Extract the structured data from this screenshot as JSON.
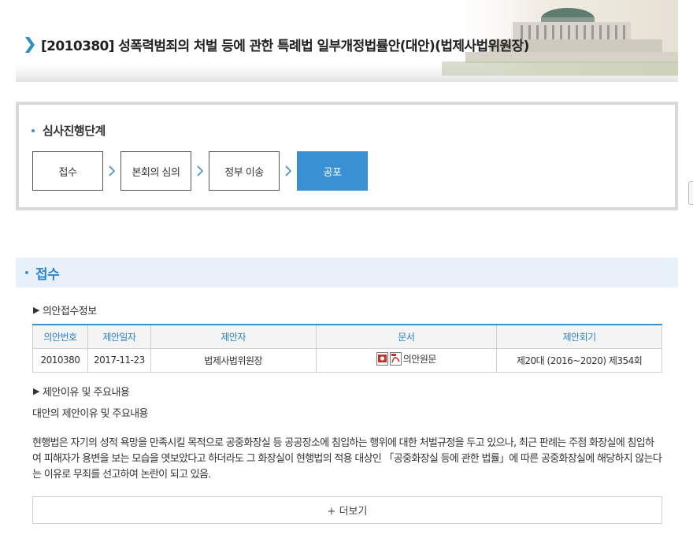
{
  "header": {
    "title": "[2010380] 성폭력범죄의 처벌 등에 관한 특례법 일부개정법률안(대안)(법제사법위원장)"
  },
  "steps": {
    "heading": "심사진행단계",
    "items": [
      {
        "label": "접수",
        "active": false
      },
      {
        "label": "본회의 심의",
        "active": false
      },
      {
        "label": "정부 이송",
        "active": false
      },
      {
        "label": "공포",
        "active": true
      }
    ]
  },
  "section": {
    "title": "접수",
    "receipt_heading": "의안접수정보",
    "table": {
      "headers": [
        "의안번호",
        "제안일자",
        "제안자",
        "문서",
        "제안회기"
      ],
      "rows": [
        {
          "bill_no": "2010380",
          "date": "2017-11-23",
          "proposer": "법제사법위원장",
          "document": "의안원문",
          "session": "제20대 (2016~2020) 제354회"
        }
      ]
    },
    "reason_heading": "제안이유 및 주요내용",
    "reason_label": "대안의 제안이유 및 주요내용",
    "reason_body": "현행법은 자기의 성적 욕망을 만족시킬 목적으로 공중화장실 등 공공장소에 침입하는 행위에 대한 처벌규정을 두고 있으나, 최근 판례는 주점 화장실에 침입하여 피해자가 용변을 보는 모습을 엿보았다고 하더라도 그 화장실이 현행법의 적용 대상인 「공중화장실 등에 관한 법률」에 따른 공중화장실에 해당하지 않는다는 이유로 무죄를 선고하여 논란이 되고 있음.",
    "more_label": "+ 더보기"
  },
  "colors": {
    "accent": "#3991d4",
    "section_bg": "#e8f1f9",
    "title_arrow": "#2a8fc6"
  },
  "icons": {
    "title": "chevron-right-icon",
    "steps": "chevron-right-icon",
    "document": "hwp-file-icon",
    "document2": "pdf-file-icon"
  }
}
